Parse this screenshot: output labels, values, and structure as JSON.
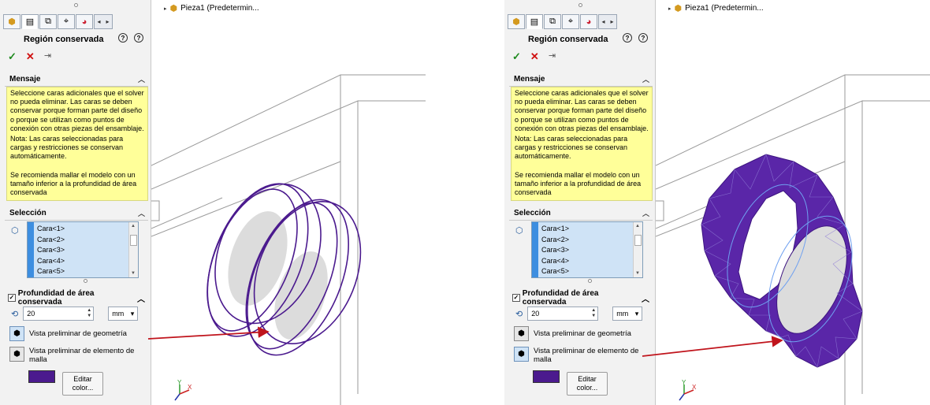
{
  "screens": [
    {
      "id": "before",
      "panel": {
        "title": "Región conservada",
        "help_icons": [
          "?",
          "?"
        ],
        "actions": {
          "ok": "✓",
          "cancel": "✕",
          "pin": "⇥"
        },
        "message_header": "Mensaje",
        "message_lines": [
          "Seleccione caras adicionales que el solver no pueda eliminar. Las caras se deben conservar porque forman parte del diseño o porque se utilizan como puntos de conexión con otras piezas del ensamblaje.",
          " Nota: Las caras seleccionadas para cargas y restricciones se conservan automáticamente.",
          "Se recomienda mallar el modelo con un tamaño inferior a la profundidad de área conservada"
        ],
        "selection_header": "Selección",
        "faces": [
          "Cara<1>",
          "Cara<2>",
          "Cara<3>",
          "Cara<4>",
          "Cara<5>"
        ],
        "depth_header": "Profundidad de área conservada",
        "depth_value": "20",
        "depth_unit": "mm",
        "preview_geometry": "Vista preliminar de geometría",
        "preview_mesh": "Vista preliminar de elemento de malla",
        "edit_color": "Editar color...",
        "color": "#4b1a8e"
      },
      "tree_label": "Pieza1  (Predetermin...",
      "preview_mode": "geometry"
    },
    {
      "id": "after",
      "panel": {
        "title": "Región conservada",
        "help_icons": [
          "?",
          "?"
        ],
        "actions": {
          "ok": "✓",
          "cancel": "✕",
          "pin": "⇥"
        },
        "message_header": "Mensaje",
        "message_lines": [
          "Seleccione caras adicionales que el solver no pueda eliminar. Las caras se deben conservar porque forman parte del diseño o porque se utilizan como puntos de conexión con otras piezas del ensamblaje.",
          " Nota: Las caras seleccionadas para cargas y restricciones se conservan automáticamente.",
          "Se recomienda mallar el modelo con un tamaño inferior a la profundidad de área conservada"
        ],
        "selection_header": "Selección",
        "faces": [
          "Cara<1>",
          "Cara<2>",
          "Cara<3>",
          "Cara<4>",
          "Cara<5>"
        ],
        "depth_header": "Profundidad de área conservada",
        "depth_value": "20",
        "depth_unit": "mm",
        "preview_geometry": "Vista preliminar de geometría",
        "preview_mesh": "Vista preliminar de elemento de malla",
        "edit_color": "Editar color...",
        "color": "#4b1a8e"
      },
      "tree_label": "Pieza1  (Predetermin...",
      "preview_mode": "mesh"
    }
  ],
  "colors": {
    "ring": "#4b1a8e",
    "mesh": "#5a26a8",
    "arrow": "#c0141c",
    "message_bg": "#ffff99",
    "selection_bg": "#cfe3f6"
  },
  "icons": [
    "check-icon",
    "close-icon",
    "pin-icon",
    "help-icon",
    "face-icon",
    "depth-icon",
    "geometry-preview-icon",
    "mesh-preview-icon",
    "part-icon",
    "triad-icon"
  ]
}
